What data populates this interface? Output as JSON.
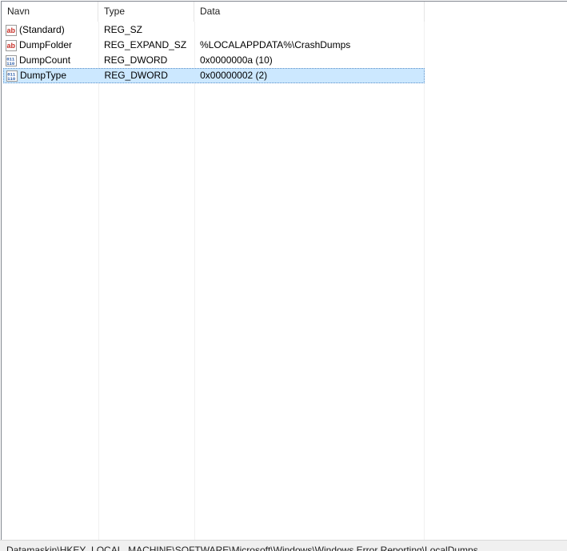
{
  "columns": {
    "name": "Navn",
    "type": "Type",
    "data": "Data"
  },
  "rows": [
    {
      "name": "(Standard)",
      "type": "REG_SZ",
      "data": "",
      "icon": "string-value-icon",
      "selected": false
    },
    {
      "name": "DumpFolder",
      "type": "REG_EXPAND_SZ",
      "data": "%LOCALAPPDATA%\\CrashDumps",
      "icon": "string-value-icon",
      "selected": false
    },
    {
      "name": "DumpCount",
      "type": "REG_DWORD",
      "data": "0x0000000a (10)",
      "icon": "binary-value-icon",
      "selected": false
    },
    {
      "name": "DumpType",
      "type": "REG_DWORD",
      "data": "0x00000002 (2)",
      "icon": "binary-value-icon",
      "selected": true
    }
  ],
  "status_bar": {
    "path": "Datamaskin\\HKEY_LOCAL_MACHINE\\SOFTWARE\\Microsoft\\Windows\\Windows Error Reporting\\LocalDumps"
  },
  "colors": {
    "selection_bg": "#cce8ff",
    "selection_border": "#5a8fc7",
    "string_icon": "#c8322a",
    "binary_icon": "#2b5da8"
  }
}
